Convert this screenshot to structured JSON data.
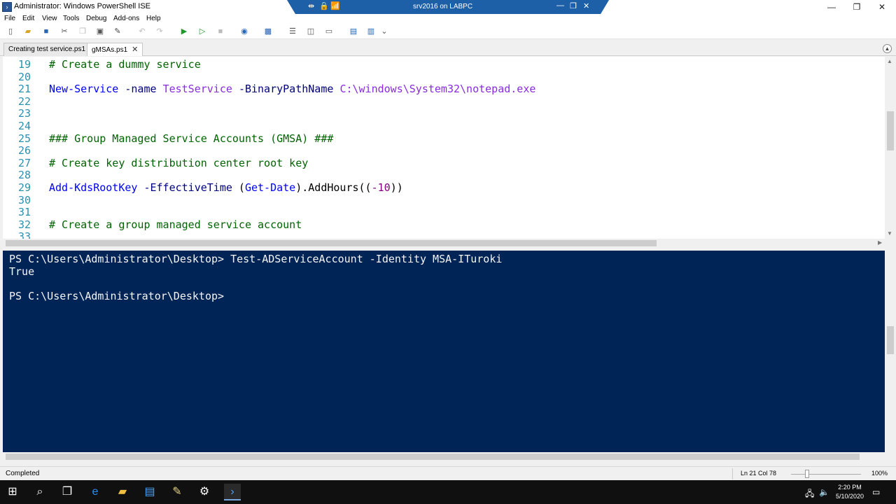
{
  "window": {
    "title": "Administrator: Windows PowerShell ISE",
    "minimize": "—",
    "restore": "❐",
    "close": "✕"
  },
  "remote": {
    "title": "srv2016 on LABPC",
    "pin": "⇹",
    "lock": "🔒",
    "signal": "📶",
    "minimize": "—",
    "restore": "❐",
    "close": "✕"
  },
  "menu": [
    "File",
    "Edit",
    "View",
    "Tools",
    "Debug",
    "Add-ons",
    "Help"
  ],
  "tabs": [
    {
      "label": "Creating test service.ps1"
    },
    {
      "label": "gMSAs.ps1",
      "close": "✕"
    }
  ],
  "editor": {
    "lines": [
      {
        "num": "19",
        "parts": [
          {
            "t": "# Create a dummy service",
            "c": "comment"
          }
        ]
      },
      {
        "num": "20",
        "parts": []
      },
      {
        "num": "21",
        "parts": [
          {
            "t": "New-Service",
            "c": "cmd"
          },
          {
            "t": " ",
            "c": "op"
          },
          {
            "t": "-name",
            "c": "param"
          },
          {
            "t": " ",
            "c": "op"
          },
          {
            "t": "TestService",
            "c": "str"
          },
          {
            "t": " ",
            "c": "op"
          },
          {
            "t": "-BinaryPathName",
            "c": "param"
          },
          {
            "t": " ",
            "c": "op"
          },
          {
            "t": "C:\\windows\\System32\\notepad.exe",
            "c": "str"
          }
        ]
      },
      {
        "num": "22",
        "parts": []
      },
      {
        "num": "23",
        "parts": []
      },
      {
        "num": "24",
        "parts": []
      },
      {
        "num": "25",
        "parts": [
          {
            "t": "### Group Managed Service Accounts (GMSA) ###",
            "c": "comment"
          }
        ]
      },
      {
        "num": "26",
        "parts": []
      },
      {
        "num": "27",
        "parts": [
          {
            "t": "# Create key distribution center root key",
            "c": "comment"
          }
        ]
      },
      {
        "num": "28",
        "parts": []
      },
      {
        "num": "29",
        "parts": [
          {
            "t": "Add-KdsRootKey",
            "c": "cmd"
          },
          {
            "t": " ",
            "c": "op"
          },
          {
            "t": "-EffectiveTime",
            "c": "param"
          },
          {
            "t": " (",
            "c": "op"
          },
          {
            "t": "Get-Date",
            "c": "cmd"
          },
          {
            "t": ").AddHours((",
            "c": "op"
          },
          {
            "t": "-10",
            "c": "num"
          },
          {
            "t": "))",
            "c": "op"
          }
        ]
      },
      {
        "num": "30",
        "parts": []
      },
      {
        "num": "31",
        "parts": []
      },
      {
        "num": "32",
        "parts": [
          {
            "t": "# Create a group managed service account",
            "c": "comment"
          }
        ]
      },
      {
        "num": "33",
        "parts": []
      }
    ]
  },
  "console": {
    "lines": [
      "PS C:\\Users\\Administrator\\Desktop> Test-ADServiceAccount -Identity MSA-ITuroki",
      "True",
      "",
      "PS C:\\Users\\Administrator\\Desktop>"
    ]
  },
  "status": {
    "text": "Completed",
    "position": "Ln 21  Col 78",
    "zoom": "100%",
    "zoom_level": 0.2
  },
  "clock": {
    "time": "2:20 PM",
    "date": "5/10/2020"
  }
}
